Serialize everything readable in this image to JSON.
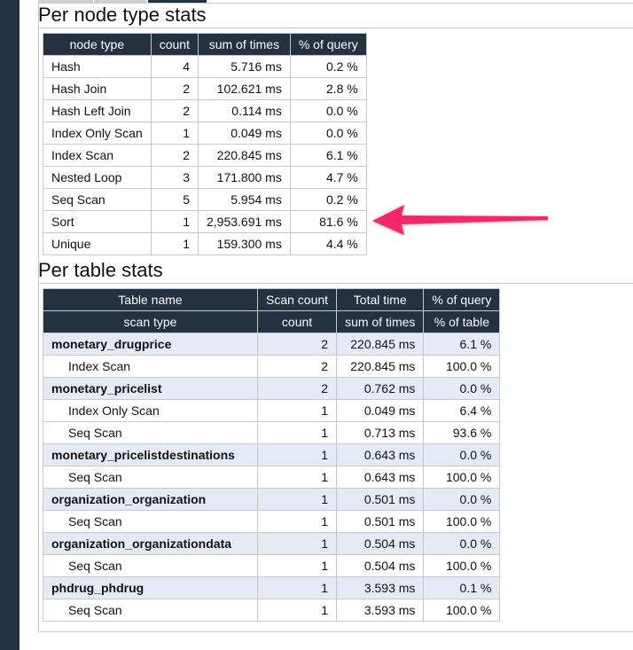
{
  "node_section": {
    "title": "Per node type stats",
    "headers": [
      "node type",
      "count",
      "sum of times",
      "% of query"
    ],
    "rows": [
      [
        "Hash",
        "4",
        "5.716 ms",
        "0.2 %"
      ],
      [
        "Hash Join",
        "2",
        "102.621 ms",
        "2.8 %"
      ],
      [
        "Hash Left Join",
        "2",
        "0.114 ms",
        "0.0 %"
      ],
      [
        "Index Only Scan",
        "1",
        "0.049 ms",
        "0.0 %"
      ],
      [
        "Index Scan",
        "2",
        "220.845 ms",
        "6.1 %"
      ],
      [
        "Nested Loop",
        "3",
        "171.800 ms",
        "4.7 %"
      ],
      [
        "Seq Scan",
        "5",
        "5.954 ms",
        "0.2 %"
      ],
      [
        "Sort",
        "1",
        "2,953.691 ms",
        "81.6 %"
      ],
      [
        "Unique",
        "1",
        "159.300 ms",
        "4.4 %"
      ]
    ]
  },
  "table_section": {
    "title": "Per table stats",
    "headers": [
      "Table name",
      "Scan count",
      "Total time",
      "% of query"
    ],
    "subheaders": [
      "scan type",
      "count",
      "sum of times",
      "% of table"
    ],
    "groups": [
      {
        "name": "monetary_drugprice",
        "count": "2",
        "time": "220.845 ms",
        "pct": "6.1 %",
        "scans": [
          [
            "Index Scan",
            "2",
            "220.845 ms",
            "100.0 %"
          ]
        ]
      },
      {
        "name": "monetary_pricelist",
        "count": "2",
        "time": "0.762 ms",
        "pct": "0.0 %",
        "scans": [
          [
            "Index Only Scan",
            "1",
            "0.049 ms",
            "6.4 %"
          ],
          [
            "Seq Scan",
            "1",
            "0.713 ms",
            "93.6 %"
          ]
        ]
      },
      {
        "name": "monetary_pricelistdestinations",
        "count": "1",
        "time": "0.643 ms",
        "pct": "0.0 %",
        "scans": [
          [
            "Seq Scan",
            "1",
            "0.643 ms",
            "100.0 %"
          ]
        ]
      },
      {
        "name": "organization_organization",
        "count": "1",
        "time": "0.501 ms",
        "pct": "0.0 %",
        "scans": [
          [
            "Seq Scan",
            "1",
            "0.501 ms",
            "100.0 %"
          ]
        ]
      },
      {
        "name": "organization_organizationdata",
        "count": "1",
        "time": "0.504 ms",
        "pct": "0.0 %",
        "scans": [
          [
            "Seq Scan",
            "1",
            "0.504 ms",
            "100.0 %"
          ]
        ]
      },
      {
        "name": "phdrug_phdrug",
        "count": "1",
        "time": "3.593 ms",
        "pct": "0.1 %",
        "scans": [
          [
            "Seq Scan",
            "1",
            "3.593 ms",
            "100.0 %"
          ]
        ]
      }
    ]
  },
  "annotation": {
    "icon": "arrow-left-icon",
    "color": "#f5286a",
    "points_to": "Sort"
  },
  "colors": {
    "header_bg": "#233140",
    "group_row_bg": "#e5ebf6",
    "sidebar_bg": "#233140"
  }
}
